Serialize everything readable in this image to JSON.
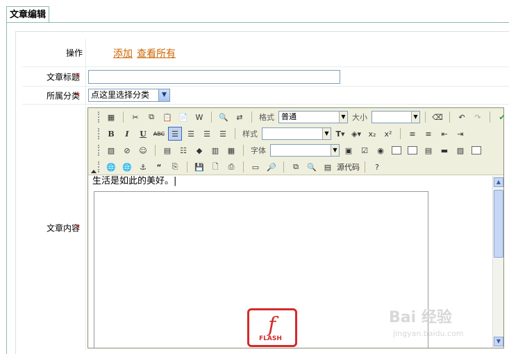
{
  "tab": {
    "label": "文章编辑"
  },
  "form": {
    "action_label": "操作",
    "add_link": "添加",
    "view_all_link": "查看所有",
    "title_label": "文章标题",
    "title_value": "",
    "category_label": "所属分类",
    "category_selected": "点这里选择分类",
    "content_label": "文章内容",
    "required_mark": "*"
  },
  "editor": {
    "format_label": "格式",
    "format_value": "普通",
    "size_label": "大小",
    "style_label": "样式",
    "font_label": "字体",
    "source_label": "源代码",
    "content_text": "生活是如此的美好。|",
    "flash_text": "FLASH"
  },
  "watermark": {
    "text": "Bai 经验",
    "sub": "jingyan.baidu.com"
  }
}
